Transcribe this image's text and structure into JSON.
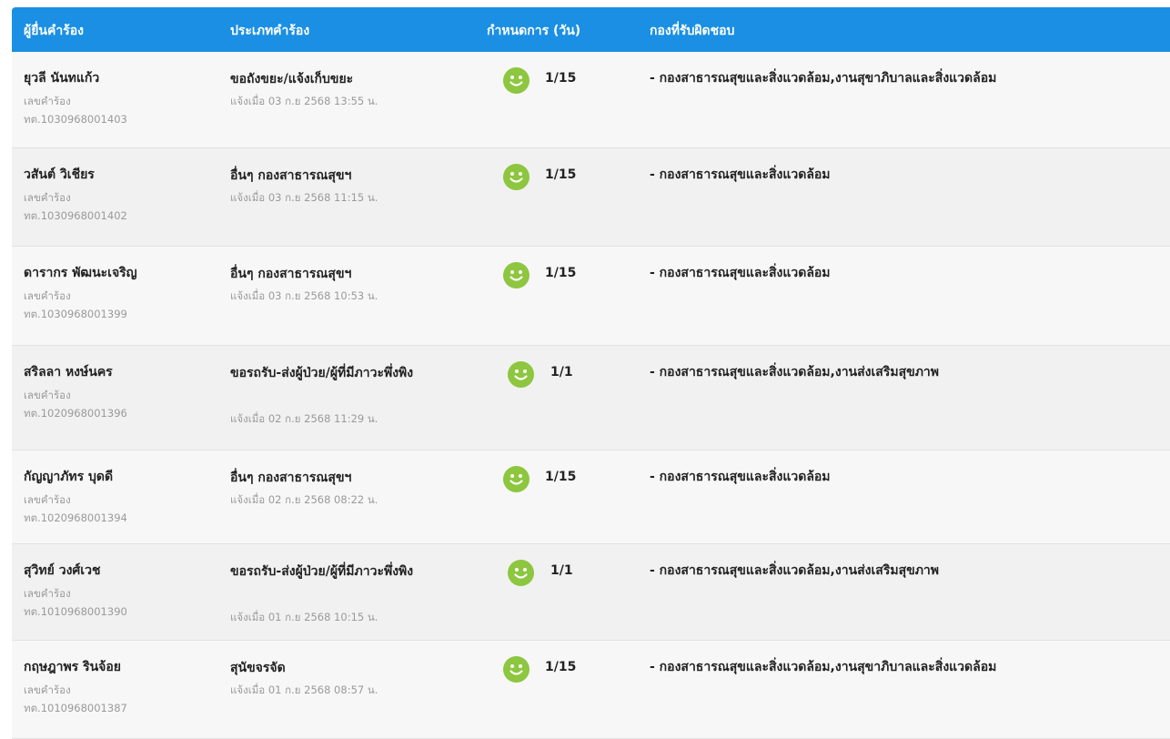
{
  "header": {
    "col_name": "ผู้ยื่นคำร้อง",
    "col_type": "ประเภทคำร้อง",
    "col_due": "กำหนดการ (วัน)",
    "col_dept": "กองที่รับผิดชอบ"
  },
  "accent_color": "#1a8fe3",
  "status_icon_color": "#8dc63f",
  "rows": [
    {
      "name": "ยุวลี นันทแก้ว",
      "req_label": "เลขคำร้อง",
      "req_no": "ทต.1030968001403",
      "type": "ขอถังขยะ/แจ้งเก็บขยะ",
      "submitted": "แจ้งเมื่อ 03 ก.ย 2568 13:55 น.",
      "status_icon": "smile-icon",
      "due": "1/15",
      "dept": "- กองสาธารณสุขและสิ่งแวดล้อม,งานสุขาภิบาลและสิ่งแวดล้อม"
    },
    {
      "name": "วสันต์ วิเชียร",
      "req_label": "เลขคำร้อง",
      "req_no": "ทต.1030968001402",
      "type": "อื่นๆ กองสาธารณสุขฯ",
      "submitted": "แจ้งเมื่อ 03 ก.ย 2568 11:15 น.",
      "status_icon": "smile-icon",
      "due": "1/15",
      "dept": "- กองสาธารณสุขและสิ่งแวดล้อม"
    },
    {
      "name": "ดารากร พัฒนะเจริญ",
      "req_label": "เลขคำร้อง",
      "req_no": "ทต.1030968001399",
      "type": "อื่นๆ กองสาธารณสุขฯ",
      "submitted": "แจ้งเมื่อ 03 ก.ย 2568 10:53 น.",
      "status_icon": "smile-icon",
      "due": "1/15",
      "dept": "- กองสาธารณสุขและสิ่งแวดล้อม"
    },
    {
      "name": "สริลลา หงษ์นคร",
      "req_label": "เลขคำร้อง",
      "req_no": "ทต.1020968001396",
      "type": "ขอรถรับ-ส่งผู้ป่วย/ผู้ที่มีภาวะพึ่งพิง",
      "submitted": "แจ้งเมื่อ 02 ก.ย 2568 11:29 น.",
      "status_icon": "smile-icon",
      "due": "1/1",
      "dept": "- กองสาธารณสุขและสิ่งแวดล้อม,งานส่งเสริมสุขภาพ"
    },
    {
      "name": "กัญญาภัทร บุดดี",
      "req_label": "เลขคำร้อง",
      "req_no": "ทต.1020968001394",
      "type": "อื่นๆ กองสาธารณสุขฯ",
      "submitted": "แจ้งเมื่อ 02 ก.ย 2568 08:22 น.",
      "status_icon": "smile-icon",
      "due": "1/15",
      "dept": "- กองสาธารณสุขและสิ่งแวดล้อม"
    },
    {
      "name": "สุวิทย์ วงศ์เวช",
      "req_label": "เลขคำร้อง",
      "req_no": "ทต.1010968001390",
      "type": "ขอรถรับ-ส่งผู้ป่วย/ผู้ที่มีภาวะพึ่งพิง",
      "submitted": "แจ้งเมื่อ 01 ก.ย 2568 10:15 น.",
      "status_icon": "smile-icon",
      "due": "1/1",
      "dept": "- กองสาธารณสุขและสิ่งแวดล้อม,งานส่งเสริมสุขภาพ"
    },
    {
      "name": "กฤษฎาพร รินจ้อย",
      "req_label": "เลขคำร้อง",
      "req_no": "ทต.1010968001387",
      "type": "สุนัขจรจัด",
      "submitted": "แจ้งเมื่อ 01 ก.ย 2568 08:57 น.",
      "status_icon": "smile-icon",
      "due": "1/15",
      "dept": "- กองสาธารณสุขและสิ่งแวดล้อม,งานสุขาภิบาลและสิ่งแวดล้อม"
    }
  ]
}
